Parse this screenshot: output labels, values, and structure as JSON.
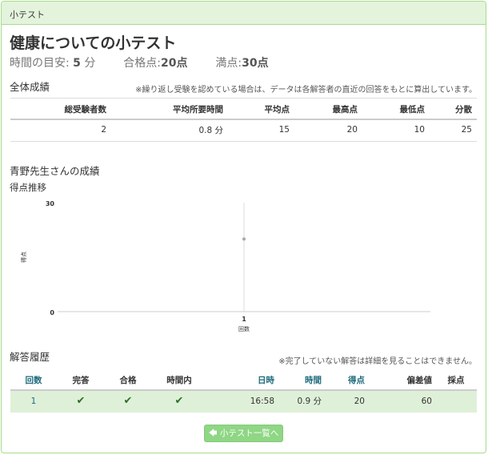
{
  "panel": {
    "heading": "小テスト"
  },
  "quiz": {
    "title": "健康についての小テスト",
    "time_label": "時間の目安:",
    "time_value": "5",
    "time_unit": "分",
    "pass_label": "合格点:",
    "pass_value": "20点",
    "full_label": "満点:",
    "full_value": "30点"
  },
  "overall": {
    "heading": "全体成績",
    "note": "※繰り返し受験を認めている場合は、データは各解答者の直近の回答をもとに算出しています。",
    "headers": [
      "総受験者数",
      "平均所要時間",
      "平均点",
      "最高点",
      "最低点",
      "分散"
    ],
    "values": [
      "2",
      "0.8 分",
      "15",
      "20",
      "10",
      "25"
    ]
  },
  "personal": {
    "heading": "青野先生さんの成績",
    "chart_heading": "得点推移"
  },
  "chart_data": {
    "type": "scatter",
    "title": "",
    "xlabel": "回数",
    "ylabel": "得点",
    "ylim": [
      0,
      30
    ],
    "y_ticks": [
      "30",
      "0"
    ],
    "x_ticks": [
      "1"
    ],
    "series": [
      {
        "x": [
          1
        ],
        "values": [
          20
        ]
      }
    ]
  },
  "history": {
    "heading": "解答履歴",
    "note": "※完了していない解答は詳細を見ることはできません。",
    "headers": [
      "回数",
      "完答",
      "合格",
      "時間内",
      "日時",
      "時間",
      "得点",
      "偏差値",
      "採点"
    ],
    "row": {
      "count": "1",
      "complete": "✔",
      "pass": "✔",
      "in_time": "✔",
      "datetime": "16:58",
      "time": "0.9 分",
      "score": "20",
      "deviation": "60",
      "grading": ""
    }
  },
  "back_button": {
    "icon": "arrow-left-icon",
    "label": "小テスト一覧へ"
  },
  "colors": {
    "accent": "#8fd685",
    "row_highlight": "#dff0d8",
    "sortable_header": "#1e6b7b"
  }
}
